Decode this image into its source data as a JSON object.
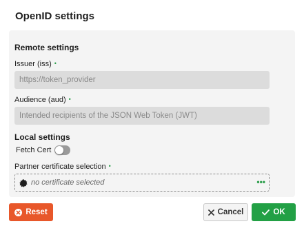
{
  "dialog": {
    "title": "OpenID settings"
  },
  "remote": {
    "section_title": "Remote settings",
    "issuer": {
      "label": "Issuer (iss)",
      "value": "",
      "placeholder": "https://token_provider"
    },
    "audience": {
      "label": "Audience (aud)",
      "value": "",
      "placeholder": "Intended recipients of the JSON Web Token (JWT)"
    },
    "required_marker": "•"
  },
  "local": {
    "section_title": "Local settings",
    "fetch_cert": {
      "label": "Fetch Cert",
      "enabled": false
    },
    "partner_cert": {
      "label": "Partner certificate selection",
      "selected_text": "no certificate selected",
      "more_label": "•••"
    }
  },
  "buttons": {
    "reset_label": "Reset",
    "cancel_label": "Cancel",
    "ok_label": "OK"
  },
  "colors": {
    "accent_green": "#22a045",
    "reset_orange": "#e8572a",
    "panel_bg": "#f4f4f4",
    "input_bg": "#dcdcdc"
  }
}
